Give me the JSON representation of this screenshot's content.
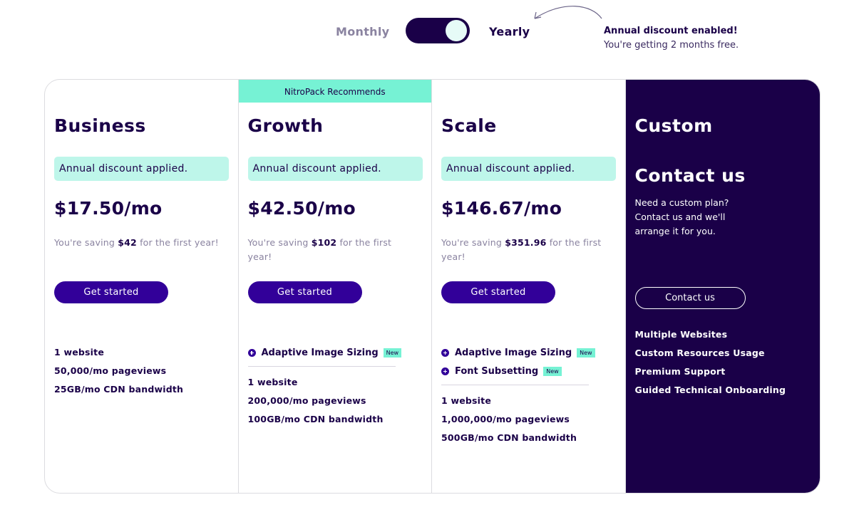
{
  "toggle": {
    "monthly_label": "Monthly",
    "yearly_label": "Yearly",
    "selected": "Yearly",
    "note_title": "Annual discount enabled!",
    "note_sub": "You're getting 2 months free."
  },
  "colors": {
    "brand_dark": "#1a0048",
    "brand_primary": "#320099",
    "accent_mint": "#76f2d4",
    "pill_mint": "#bef6ea"
  },
  "plans": [
    {
      "name": "Business",
      "discount": "Annual discount applied.",
      "price": "$17.50/mo",
      "saving_prefix": "You're saving ",
      "saving_amount": "$42",
      "saving_suffix": " for the first year!",
      "cta": "Get started",
      "new_features": [],
      "features": [
        "1 website",
        "50,000/mo pageviews",
        "25GB/mo CDN bandwidth"
      ]
    },
    {
      "name": "Growth",
      "banner": "NitroPack Recommends",
      "discount": "Annual discount applied.",
      "price": "$42.50/mo",
      "saving_prefix": "You're saving ",
      "saving_amount": "$102",
      "saving_suffix": " for the first year!",
      "cta": "Get started",
      "new_features": [
        {
          "label": "Adaptive Image Sizing",
          "badge": "New"
        }
      ],
      "features": [
        "1 website",
        "200,000/mo pageviews",
        "100GB/mo CDN bandwidth"
      ]
    },
    {
      "name": "Scale",
      "discount": "Annual discount applied.",
      "price": "$146.67/mo",
      "saving_prefix": "You're saving ",
      "saving_amount": "$351.96",
      "saving_suffix": " for the first year!",
      "cta": "Get started",
      "new_features": [
        {
          "label": "Adaptive Image Sizing",
          "badge": "New"
        },
        {
          "label": "Font Subsetting",
          "badge": "New"
        }
      ],
      "features": [
        "1 website",
        "1,000,000/mo pageviews",
        "500GB/mo CDN bandwidth"
      ]
    }
  ],
  "custom": {
    "name": "Custom",
    "title": "Contact us",
    "description": "Need a custom plan? Contact us and we'll arrange it for you.",
    "cta": "Contact us",
    "features": [
      "Multiple Websites",
      "Custom Resources Usage",
      "Premium Support",
      "Guided Technical Onboarding"
    ]
  }
}
